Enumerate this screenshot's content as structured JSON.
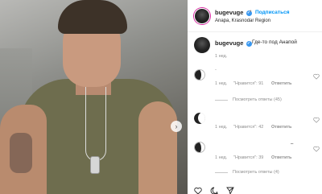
{
  "post": {
    "account": {
      "handle": "bugevuge",
      "follow_label": "Подписаться",
      "location": "Anapa, Krasnodar Region",
      "separator": "•"
    },
    "caption": {
      "text": "Где-то под Анапой",
      "age": "1 нед."
    },
    "comments": [
      {
        "text": "·",
        "age": "1 нед.",
        "likes": "\"Нравится\": 91",
        "reply_label": "Ответить",
        "view_replies": "Посмотреть ответы (45)"
      },
      {
        "text": "",
        "age": "1 нед.",
        "likes": "\"Нравится\": 42",
        "reply_label": "Ответить",
        "view_replies": ""
      },
      {
        "text": "–",
        "age": "1 нед.",
        "likes": "\"Нравится\": 39",
        "reply_label": "Ответить",
        "view_replies": "Посмотреть ответы (4)"
      }
    ],
    "carousel": {
      "next_symbol": "›"
    }
  },
  "colors": {
    "accent": "#0095f6",
    "verified": "#3897f0"
  },
  "icons": [
    "verified-badge-icon",
    "heart-icon",
    "comment-icon",
    "share-icon",
    "next-arrow-icon"
  ]
}
